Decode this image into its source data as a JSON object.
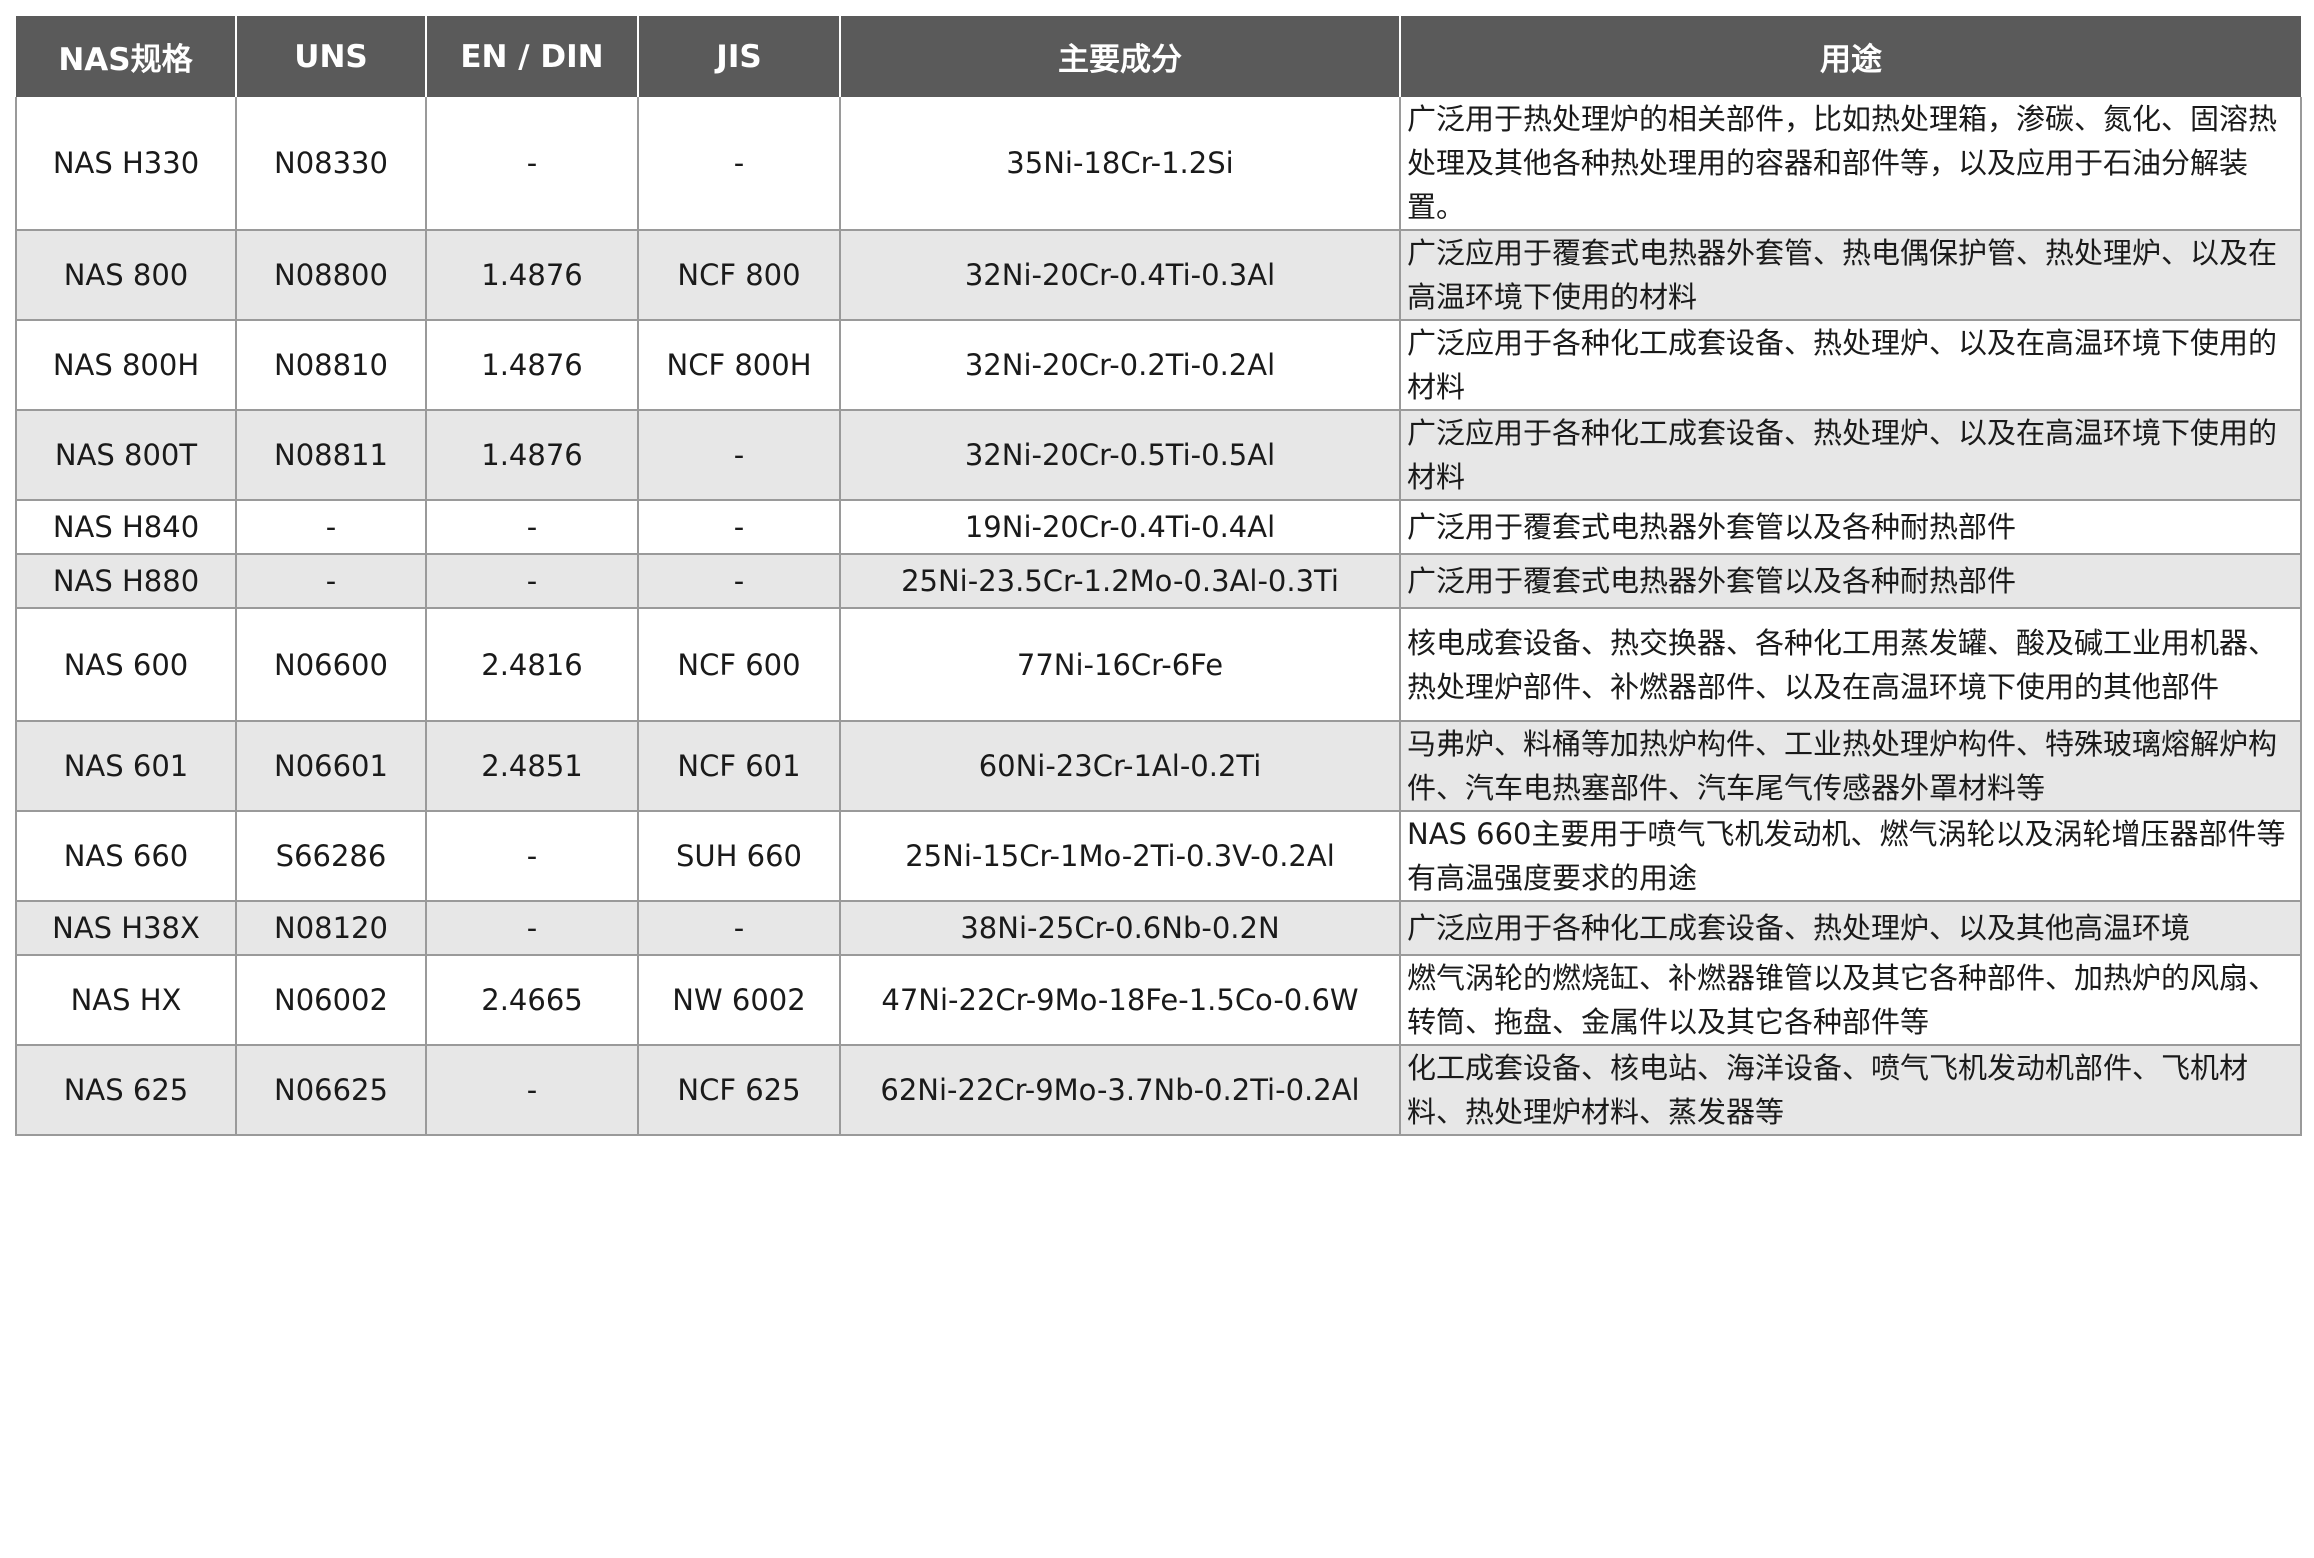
{
  "headers": [
    "NAS规格",
    "UNS",
    "EN / DIN",
    "JIS",
    "主要成分",
    "用途"
  ],
  "rows": [
    {
      "nas": "NAS H330",
      "uns": "N08330",
      "en": "-",
      "jis": "-",
      "comp": "35Ni-18Cr-1.2Si",
      "use": "广泛用于热处理炉的相关部件，比如热处理箱，渗碳、氮化、固溶热处理及其他各种热处理用的容器和部件等，以及应用于石油分解装置。"
    },
    {
      "nas": "NAS 800",
      "uns": "N08800",
      "en": "1.4876",
      "jis": "NCF 800",
      "comp": "32Ni-20Cr-0.4Ti-0.3Al",
      "use": "广泛应用于覆套式电热器外套管、热电偶保护管、热处理炉、以及在高温环境下使用的材料"
    },
    {
      "nas": "NAS 800H",
      "uns": "N08810",
      "en": "1.4876",
      "jis": "NCF 800H",
      "comp": "32Ni-20Cr-0.2Ti-0.2Al",
      "use": "广泛应用于各种化工成套设备、热处理炉、以及在高温环境下使用的材料"
    },
    {
      "nas": "NAS 800T",
      "uns": "N08811",
      "en": "1.4876",
      "jis": "-",
      "comp": "32Ni-20Cr-0.5Ti-0.5Al",
      "use": "广泛应用于各种化工成套设备、热处理炉、以及在高温环境下使用的材料"
    },
    {
      "nas": "NAS H840",
      "uns": "-",
      "en": "-",
      "jis": "-",
      "comp": "19Ni-20Cr-0.4Ti-0.4Al",
      "use": "广泛用于覆套式电热器外套管以及各种耐热部件"
    },
    {
      "nas": "NAS H880",
      "uns": "-",
      "en": "-",
      "jis": "-",
      "comp": "25Ni-23.5Cr-1.2Mo-0.3Al-0.3Ti",
      "use": "广泛用于覆套式电热器外套管以及各种耐热部件"
    },
    {
      "nas": "NAS 600",
      "uns": "N06600",
      "en": "2.4816",
      "jis": "NCF 600",
      "comp": "77Ni-16Cr-6Fe",
      "use": "核电成套设备、热交换器、各种化工用蒸发罐、酸及碱工业用机器、热处理炉部件、补燃器部件、以及在高温环境下使用的其他部件"
    },
    {
      "nas": "NAS 601",
      "uns": "N06601",
      "en": "2.4851",
      "jis": "NCF 601",
      "comp": "60Ni-23Cr-1Al-0.2Ti",
      "use": "马弗炉、料桶等加热炉构件、工业热处理炉构件、特殊玻璃熔解炉构件、汽车电热塞部件、汽车尾气传感器外罩材料等"
    },
    {
      "nas": "NAS 660",
      "uns": "S66286",
      "en": "-",
      "jis": "SUH 660",
      "comp": "25Ni-15Cr-1Mo-2Ti-0.3V-0.2Al",
      "use": "NAS 660主要用于喷气飞机发动机、燃气涡轮以及涡轮增压器部件等有高温强度要求的用途"
    },
    {
      "nas": "NAS H38X",
      "uns": "N08120",
      "en": "-",
      "jis": "-",
      "comp": "38Ni-25Cr-0.6Nb-0.2N",
      "use": "广泛应用于各种化工成套设备、热处理炉、以及其他高温环境"
    },
    {
      "nas": "NAS HX",
      "uns": "N06002",
      "en": "2.4665",
      "jis": "NW 6002",
      "comp": "47Ni-22Cr-9Mo-18Fe-1.5Co-0.6W",
      "use": "燃气涡轮的燃烧缸、补燃器锥管以及其它各种部件、加热炉的风扇、转筒、拖盘、金属件以及其它各种部件等"
    },
    {
      "nas": "NAS 625",
      "uns": "N06625",
      "en": "-",
      "jis": "NCF 625",
      "comp": "62Ni-22Cr-9Mo-3.7Nb-0.2Ti-0.2Al",
      "use": "化工成套设备、核电站、海洋设备、喷气飞机发动机部件、飞机材料、热处理炉材料、蒸发器等"
    }
  ]
}
